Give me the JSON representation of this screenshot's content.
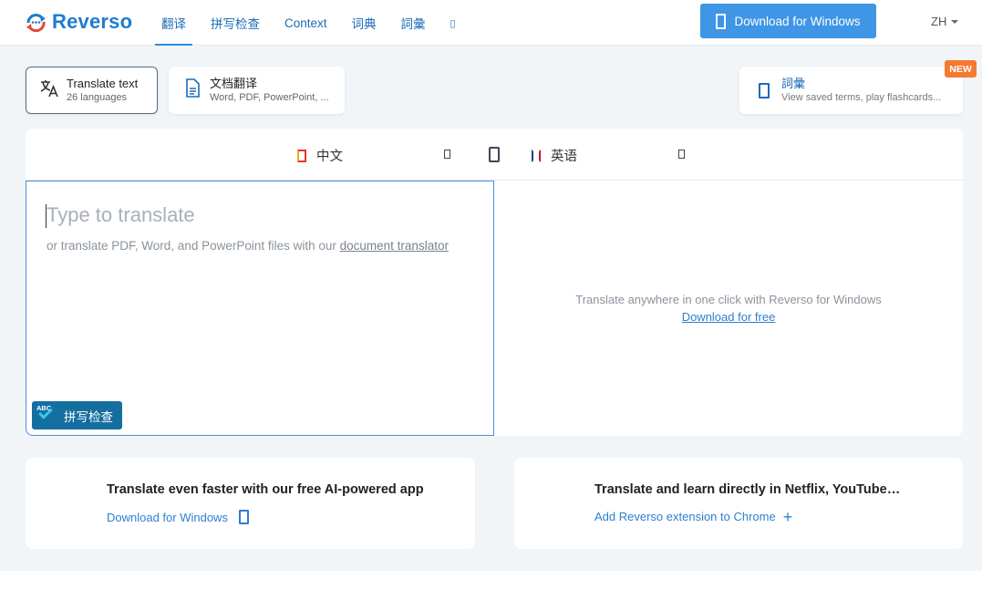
{
  "brand": {
    "name": "Reverso",
    "accent": "#1f7bd1"
  },
  "nav": {
    "items": [
      {
        "label": "翻译",
        "active": true
      },
      {
        "label": "拼写检查",
        "active": false
      },
      {
        "label": "Context",
        "active": false
      },
      {
        "label": "词典",
        "active": false
      },
      {
        "label": "詞彙",
        "active": false
      },
      {
        "label": "▯",
        "active": false
      }
    ]
  },
  "header": {
    "download_label": "Download for Windows",
    "ui_language": "ZH"
  },
  "modes": {
    "translate_text": {
      "title": "Translate text",
      "sub": "26 languages"
    },
    "documents": {
      "title": "文档翻译",
      "sub": "Word, PDF, PowerPoint, ..."
    },
    "vocab": {
      "title": "詞彙",
      "sub": "View saved terms, play flashcards...",
      "badge": "NEW"
    }
  },
  "translator": {
    "source_lang": "中文",
    "target_lang": "英语",
    "placeholder": "Type to translate",
    "hint_prefix": "or translate PDF, Word, and PowerPoint files with our ",
    "hint_link": "document translator",
    "spellcheck_abc": "ABC",
    "spellcheck_label": "拼写检查",
    "target_message": "Translate anywhere in one click with Reverso for Windows",
    "target_link": "Download for free"
  },
  "promos": [
    {
      "title": "Translate even faster with our free AI-powered app",
      "link": "Download for Windows",
      "icon": "windows-icon"
    },
    {
      "title": "Translate and learn directly in Netflix, YouTube…",
      "link": "Add Reverso extension to Chrome",
      "icon": "plus-icon"
    }
  ]
}
